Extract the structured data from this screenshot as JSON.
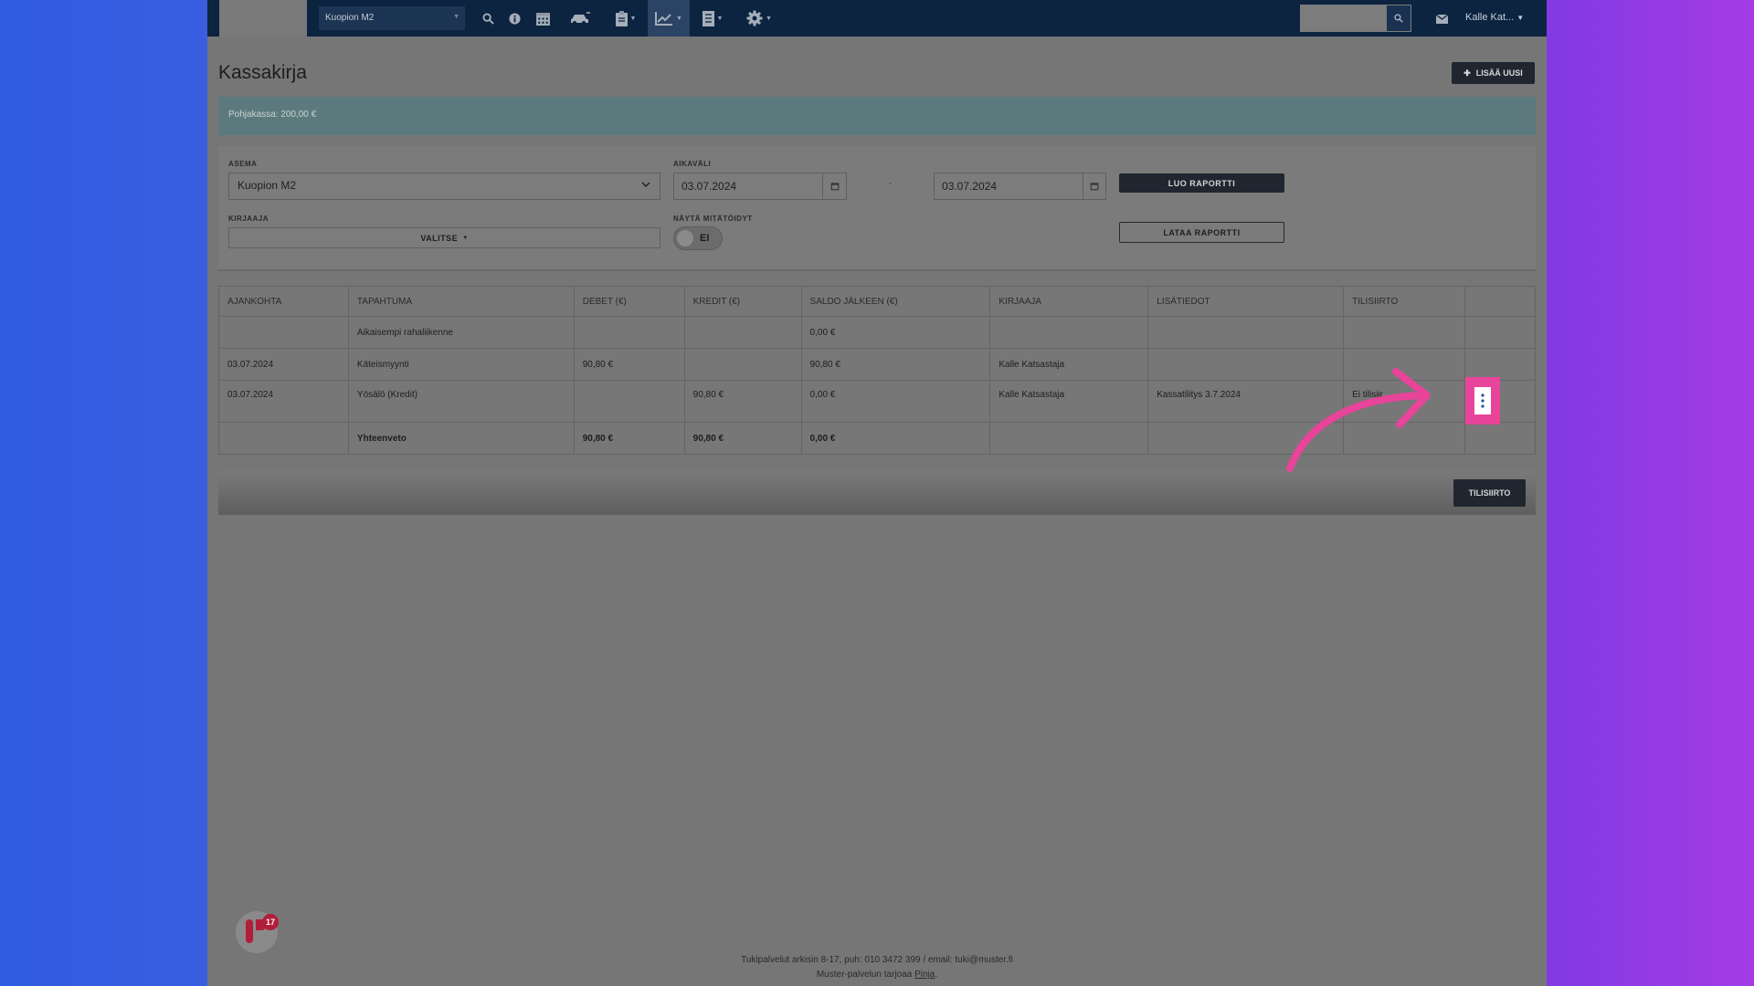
{
  "nav": {
    "station": "Kuopion M2",
    "user": "Kalle Kat...",
    "icons": [
      "search-icon",
      "info-icon",
      "calendar-icon",
      "car-icon",
      "clipboard-icon",
      "chart-icon",
      "document-icon",
      "gear-icon"
    ]
  },
  "page": {
    "title": "Kassakirja",
    "add_new": "LISÄÄ UUSI",
    "info": "Pohjakassa: 200,00 €"
  },
  "filters": {
    "station_label": "ASEMA",
    "station_value": "Kuopion M2",
    "range_label": "AIKAVÄLI",
    "date_from": "03.07.2024",
    "date_to": "03.07.2024",
    "range_dash": "-",
    "create_report": "LUO RAPORTTI",
    "recorder_label": "KIRJAAJA",
    "recorder_value": "VALITSE",
    "show_void_label": "NÄYTÄ MITÄTÖIDYT",
    "show_void_value": "EI",
    "download_report": "LATAA RAPORTTI"
  },
  "table": {
    "headers": [
      "AJANKOHTA",
      "TAPAHTUMA",
      "DEBET (€)",
      "KREDIT (€)",
      "SALDO JÄLKEEN (€)",
      "KIRJAAJA",
      "LISÄTIEDOT",
      "TILISIIRTO",
      ""
    ],
    "rows": [
      [
        "",
        "Aikaisempi rahaliikenne",
        "",
        "",
        "0,00 €",
        "",
        "",
        "",
        ""
      ],
      [
        "03.07.2024",
        "Käteismyynti",
        "90,80 €",
        "",
        "90,80 €",
        "Kalle Katsastaja",
        "",
        "",
        ""
      ],
      [
        "03.07.2024",
        "Yösälö (Kredit)",
        "",
        "90,80 €",
        "0,00 €",
        "Kalle Katsastaja",
        "Kassatilitys 3.7.2024",
        "Ei tilisiir",
        ""
      ]
    ],
    "summary": [
      "",
      "Yhteenveto",
      "90,80 €",
      "90,80 €",
      "0,00 €",
      "",
      "",
      "",
      ""
    ]
  },
  "transfer_button": "TILISIIRTO",
  "footer": {
    "support": "Tukipalvelut arkisin 8-17, puh: 010 3472 399 / email: tuki@muster.fi",
    "provided_by": "Muster-palvelun tarjoaa",
    "provider": "Pinja",
    "period": "."
  },
  "widget_badge": "17",
  "colors": {
    "highlight": "#e8449a",
    "nav_bg": "#0c2440",
    "button_dark": "#1f2630"
  }
}
